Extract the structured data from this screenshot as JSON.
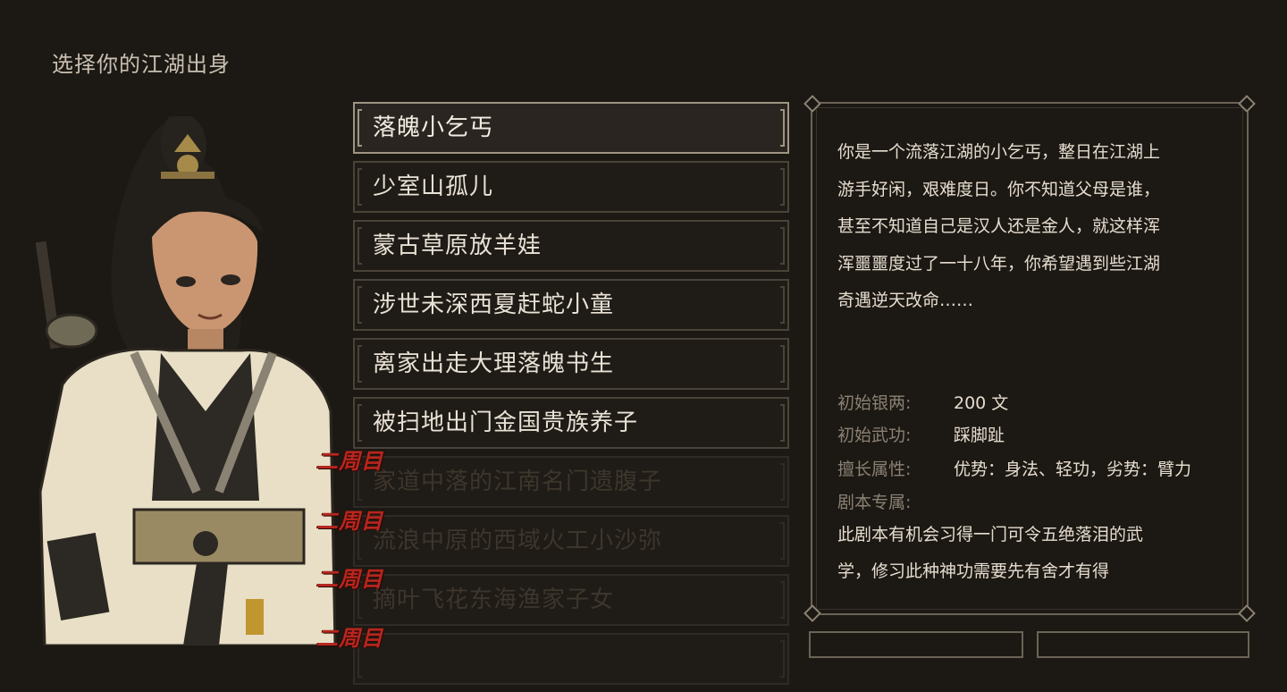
{
  "page": {
    "title": "选择你的江湖出身"
  },
  "origins": [
    {
      "label": "落魄小乞丐",
      "state": "selected"
    },
    {
      "label": "少室山孤儿",
      "state": "available"
    },
    {
      "label": "蒙古草原放羊娃",
      "state": "available"
    },
    {
      "label": "涉世未深西夏赶蛇小童",
      "state": "available"
    },
    {
      "label": "离家出走大理落魄书生",
      "state": "available"
    },
    {
      "label": "被扫地出门金国贵族养子",
      "state": "available"
    },
    {
      "label": "家道中落的江南名门遗腹子",
      "state": "locked",
      "badge": "二周目"
    },
    {
      "label": "流浪中原的西域火工小沙弥",
      "state": "locked",
      "badge": "二周目"
    },
    {
      "label": "摘叶飞花东海渔家子女",
      "state": "locked",
      "badge": "二周目"
    },
    {
      "badge": "二周目"
    }
  ],
  "detail": {
    "description_lines": [
      "你是一个流落江湖的小乞丐，整日在江湖上",
      "游手好闲，艰难度日。你不知道父母是谁，",
      "甚至不知道自己是汉人还是金人，就这样浑",
      "浑噩噩度过了一十八年，你希望遇到些江湖",
      "奇遇逆天改命……"
    ],
    "stats": [
      {
        "label": "初始银两:",
        "value": "200 文"
      },
      {
        "label": "初始武功:",
        "value": "踩脚趾"
      },
      {
        "label": "擅长属性:",
        "value": "优势：身法、轻功，劣势：臂力"
      },
      {
        "label": "剧本专属:",
        "value": ""
      }
    ],
    "exclusive_lines": [
      "此剧本有机会习得一门可令五绝落泪的武",
      "学，修习此种神功需要先有舍才有得"
    ]
  },
  "colors": {
    "background": "#1c1813",
    "frame": "#6b6357",
    "badge_red": "#b8261e",
    "text": "#e6ddd0",
    "label": "#8a8174"
  }
}
